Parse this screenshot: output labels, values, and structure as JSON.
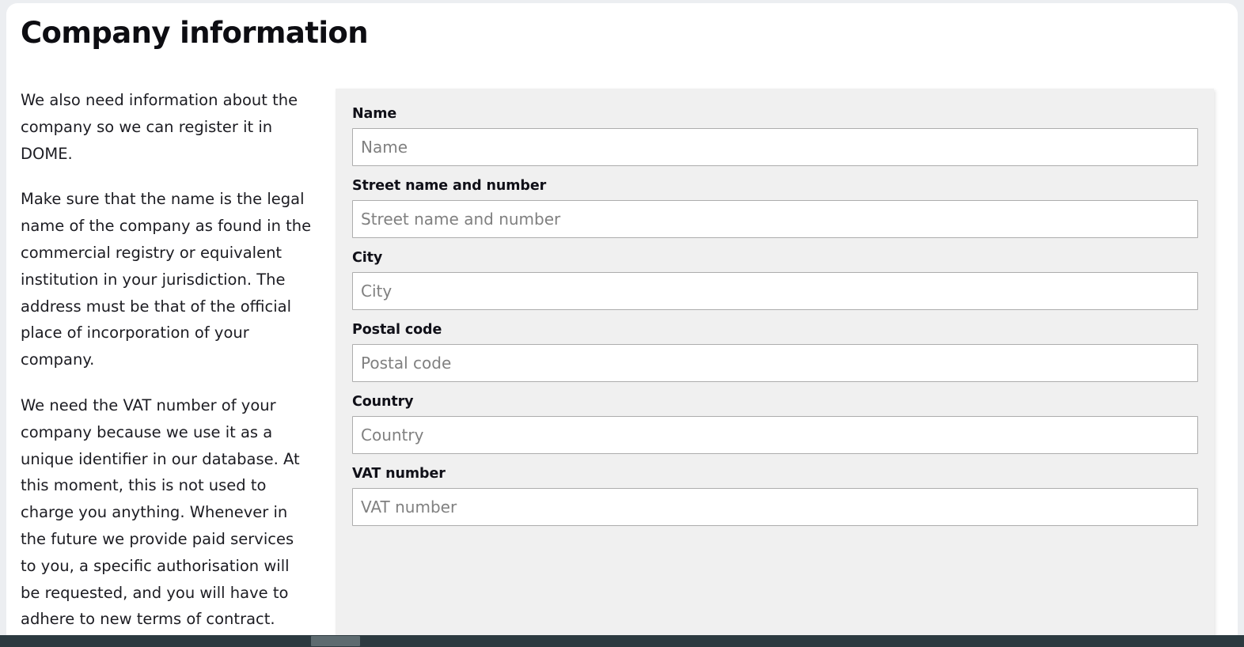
{
  "page": {
    "title": "Company information"
  },
  "intro": {
    "paragraphs": [
      "We also need information about the company so we can register it in DOME.",
      "Make sure that the name is the legal name of the company as found in the commercial registry or equivalent institution in your jurisdiction. The address must be that of the official place of incorporation of your company.",
      "We need the VAT number of your company because we use it as a unique identifier in our database. At this moment, this is not used to charge you anything. Whenever in the future we provide paid services to you, a specific authorisation will be requested, and you will have to adhere to new terms of contract."
    ]
  },
  "form": {
    "fields": [
      {
        "label": "Name",
        "placeholder": "Name",
        "value": ""
      },
      {
        "label": "Street name and number",
        "placeholder": "Street name and number",
        "value": ""
      },
      {
        "label": "City",
        "placeholder": "City",
        "value": ""
      },
      {
        "label": "Postal code",
        "placeholder": "Postal code",
        "value": ""
      },
      {
        "label": "Country",
        "placeholder": "Country",
        "value": ""
      },
      {
        "label": "VAT number",
        "placeholder": "VAT number",
        "value": ""
      }
    ]
  },
  "scrollbar": {
    "orientation": "horizontal",
    "track_color": "#2c3a40",
    "thumb_color": "#5d6b70"
  },
  "colors": {
    "card_background": "#ffffff",
    "panel_background": "#f0f0f0",
    "page_background": "#eceef1",
    "input_border": "#adadad",
    "placeholder_text": "#808080",
    "label_text": "#101018",
    "body_text": "#1c1c22"
  }
}
